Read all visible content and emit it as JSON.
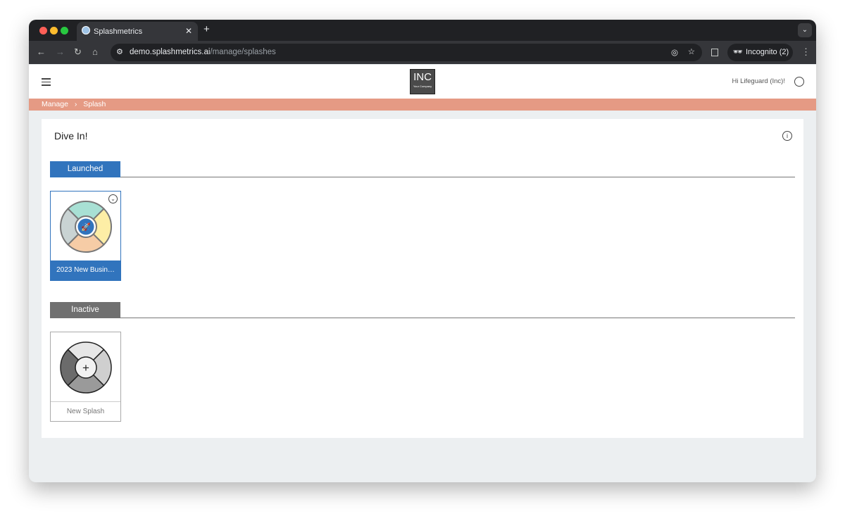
{
  "browser": {
    "tab_title": "Splashmetrics",
    "url_host": "demo.splashmetrics.ai",
    "url_path": "/manage/splashes",
    "incognito_label": "Incognito (2)"
  },
  "header": {
    "logo_text": "INC",
    "logo_subtext": "Your Company",
    "greeting": "Hi Lifeguard (Inc)!"
  },
  "breadcrumb": {
    "items": [
      "Manage",
      "Splash"
    ]
  },
  "main": {
    "title": "Dive In!",
    "sections": [
      {
        "label": "Launched",
        "color": "#3174bd",
        "items": [
          {
            "name": "2023 New Busin…"
          }
        ]
      },
      {
        "label": "Inactive",
        "color": "#707070",
        "items": [
          {
            "name": "New Splash"
          }
        ]
      }
    ]
  },
  "colors": {
    "breadcrumb_bg": "#e59a84",
    "accent": "#3174bd"
  }
}
